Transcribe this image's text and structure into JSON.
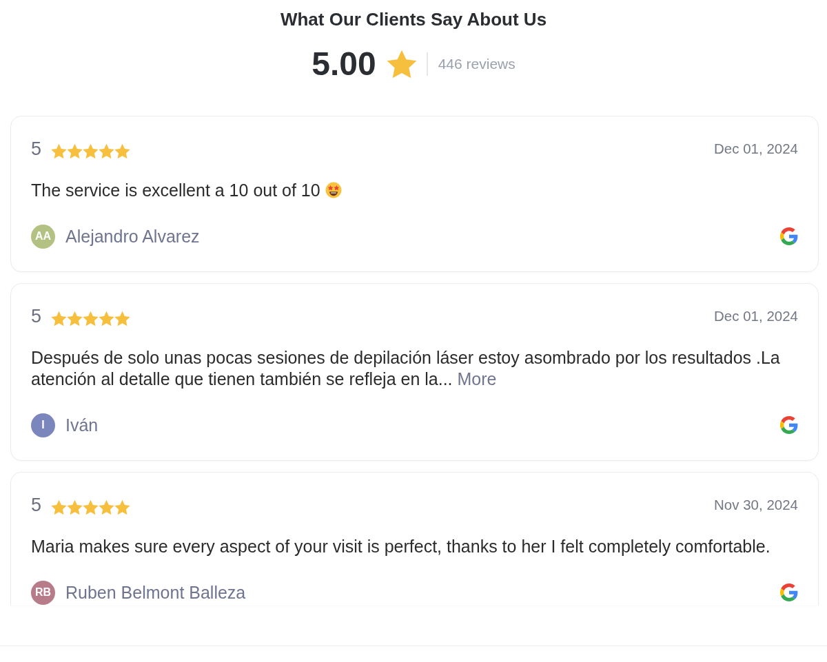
{
  "title": "What Our Clients Say About Us",
  "summary": {
    "score": "5.00",
    "review_count": "446 reviews"
  },
  "reviews": [
    {
      "rating": "5",
      "stars": 5,
      "date": "Dec 01, 2024",
      "text": "The service is excellent a 10 out of 10",
      "emoji": true,
      "author": {
        "initials": "AA",
        "name": "Alejandro Alvarez",
        "color": "#b3c183"
      }
    },
    {
      "rating": "5",
      "stars": 5,
      "date": "Dec 01, 2024",
      "text": "Después de solo unas pocas sesiones de depilación láser estoy asombrado por los resultados .La atención al detalle que tienen también se refleja en la...",
      "more_link": "More",
      "emoji": false,
      "author": {
        "initials": "I",
        "name": "Iván",
        "color": "#7b86bd"
      }
    },
    {
      "rating": "5",
      "stars": 5,
      "date": "Nov 30, 2024",
      "text": "Maria makes sure every aspect of your visit is perfect, thanks to her I felt completely comfortable.",
      "emoji": false,
      "author": {
        "initials": "RB",
        "name": "Ruben Belmont Balleza",
        "color": "#b87b8a"
      }
    }
  ]
}
